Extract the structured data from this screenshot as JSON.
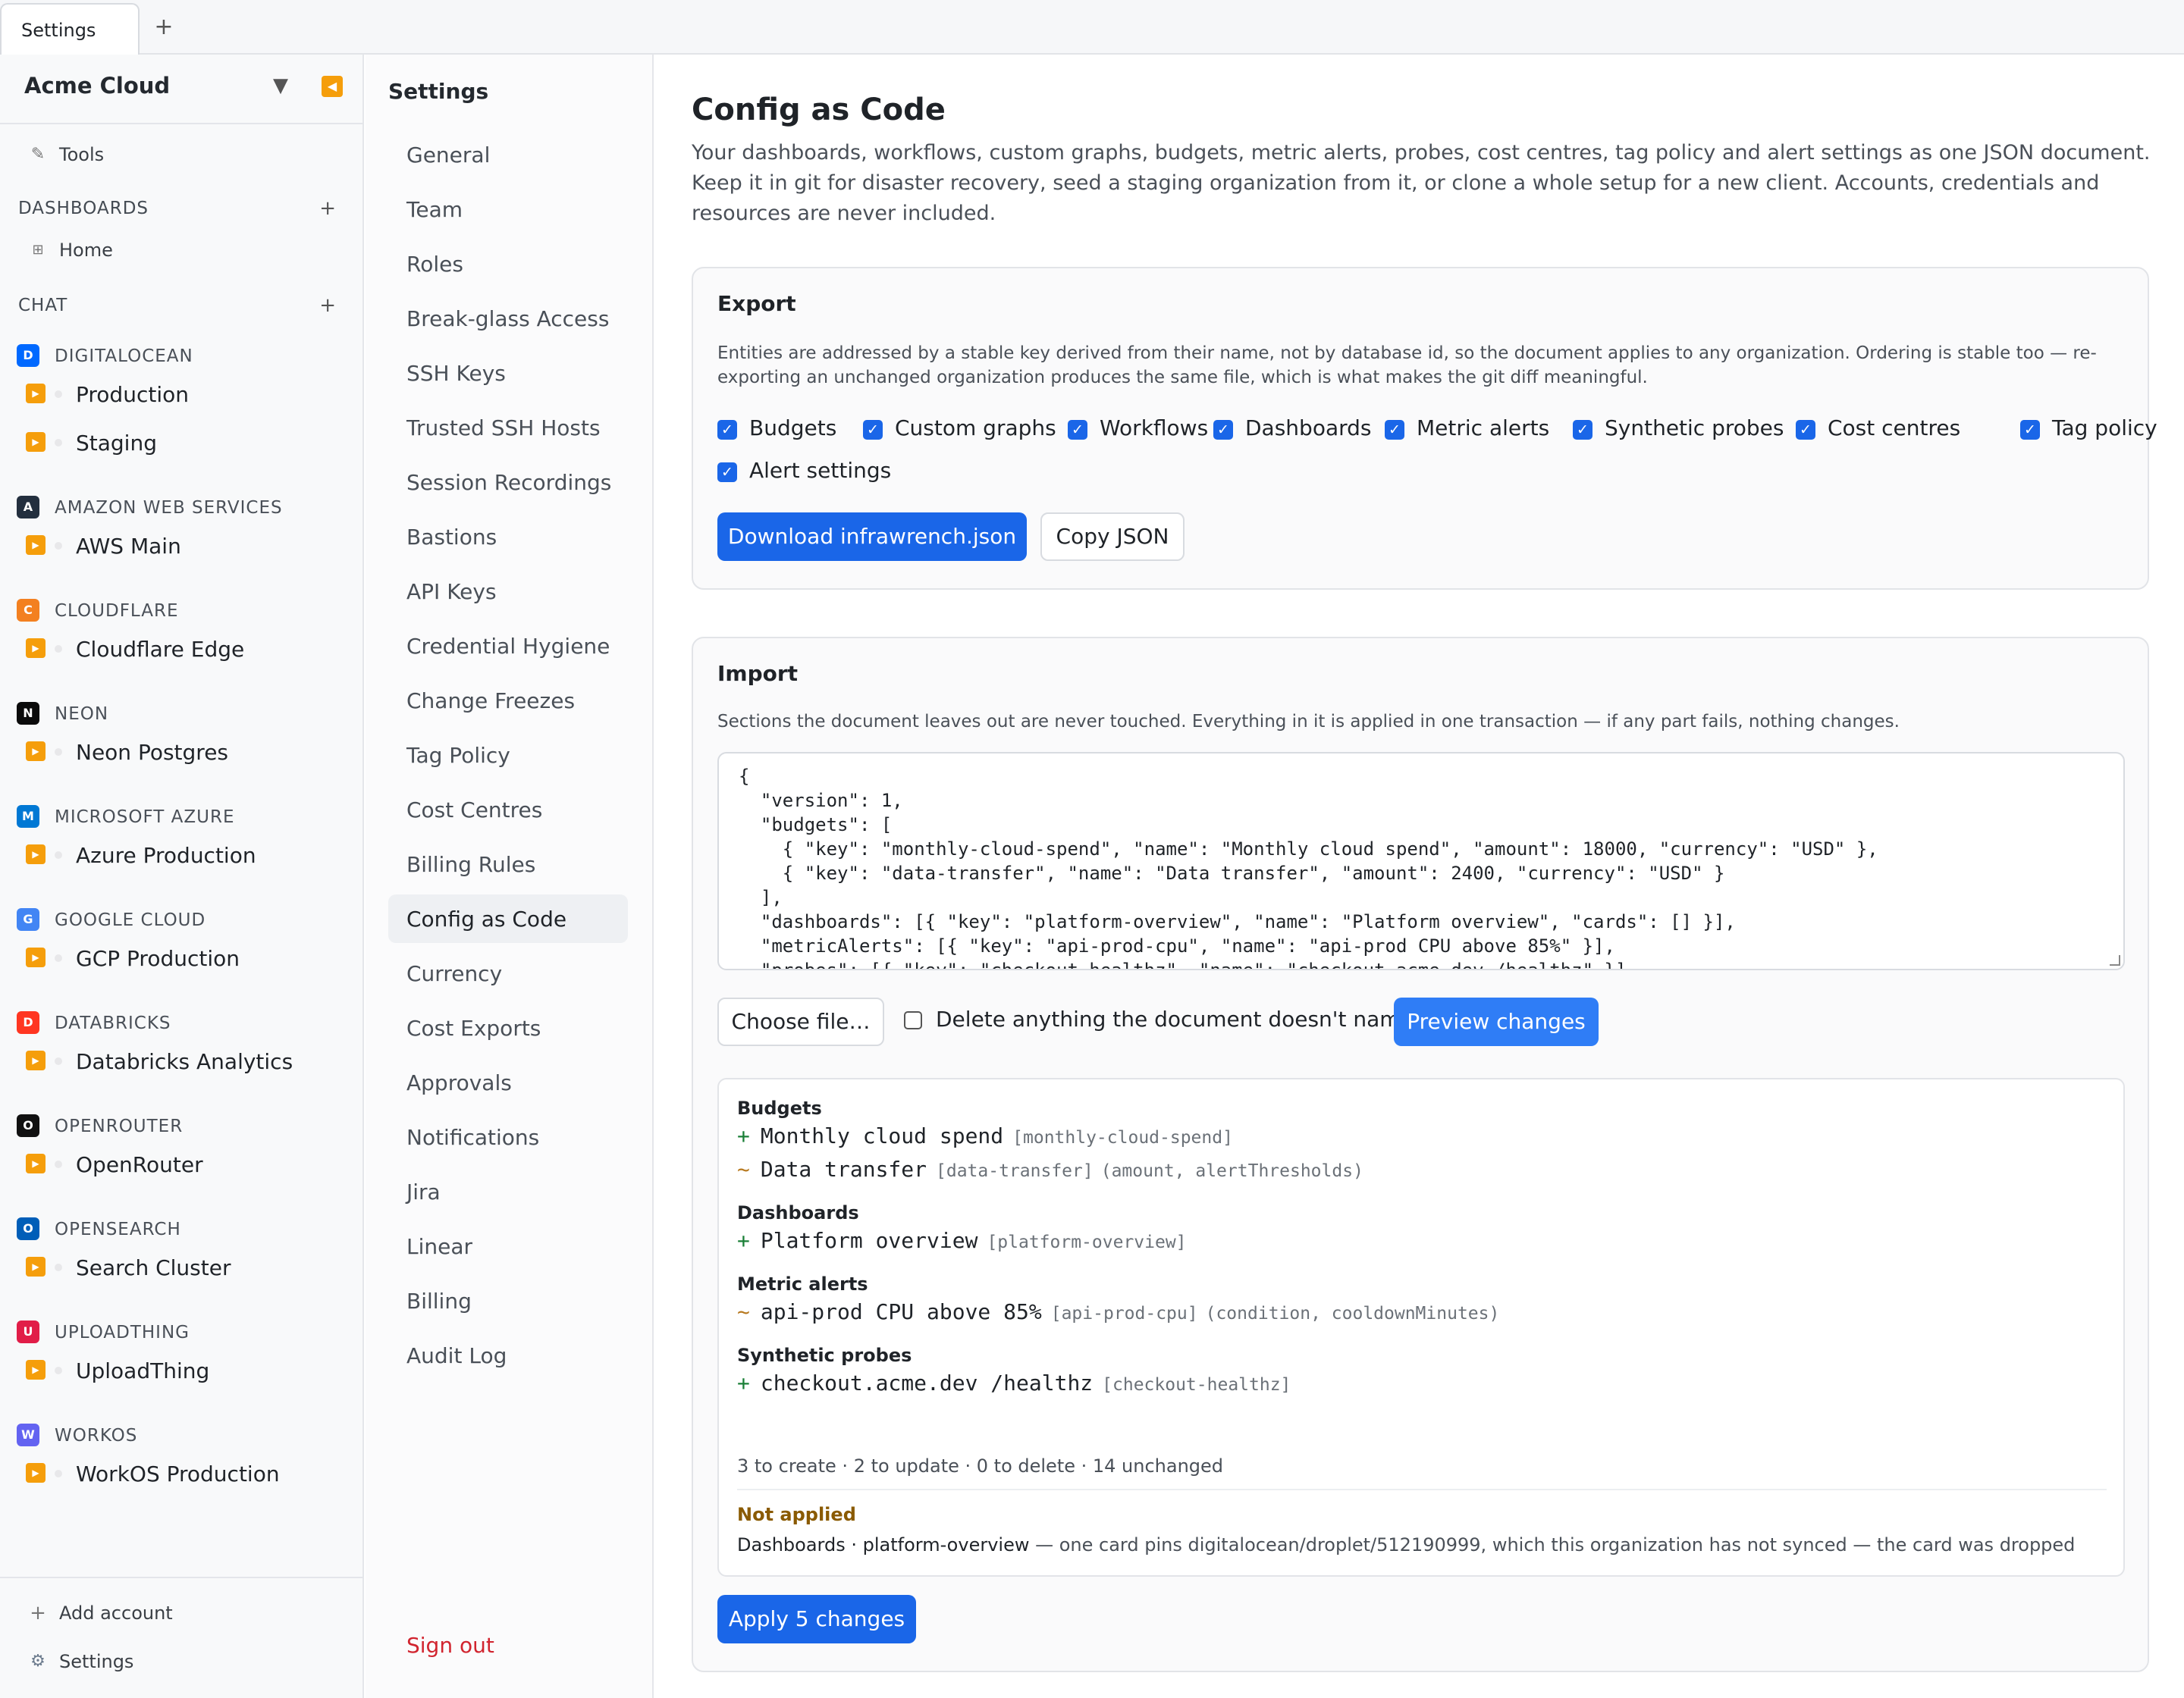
{
  "tabs": {
    "active": "Settings",
    "add": "+"
  },
  "sidebar": {
    "org_name": "Acme Cloud",
    "tools_label": "Tools",
    "dashboards_section": "DASHBOARDS",
    "home_label": "Home",
    "chat_section": "CHAT",
    "providers": [
      {
        "name": "DIGITALOCEAN",
        "color": "#0069ff",
        "accounts": [
          "Production",
          "Staging"
        ]
      },
      {
        "name": "AMAZON WEB SERVICES",
        "color": "#232f3e",
        "accounts": [
          "AWS Main"
        ]
      },
      {
        "name": "CLOUDFLARE",
        "color": "#f38020",
        "accounts": [
          "Cloudflare Edge"
        ]
      },
      {
        "name": "NEON",
        "color": "#0b0b0b",
        "accounts": [
          "Neon Postgres"
        ]
      },
      {
        "name": "MICROSOFT AZURE",
        "color": "#0078d4",
        "accounts": [
          "Azure Production"
        ]
      },
      {
        "name": "GOOGLE CLOUD",
        "color": "#4285f4",
        "accounts": [
          "GCP Production"
        ]
      },
      {
        "name": "DATABRICKS",
        "color": "#ff3621",
        "accounts": [
          "Databricks Analytics"
        ]
      },
      {
        "name": "OPENROUTER",
        "color": "#111111",
        "accounts": [
          "OpenRouter"
        ]
      },
      {
        "name": "OPENSEARCH",
        "color": "#005eb8",
        "accounts": [
          "Search Cluster"
        ]
      },
      {
        "name": "UPLOADTHING",
        "color": "#e11d48",
        "accounts": [
          "UploadThing"
        ]
      },
      {
        "name": "WORKOS",
        "color": "#6363f1",
        "accounts": [
          "WorkOS Production"
        ]
      }
    ],
    "add_account": "Add account",
    "settings": "Settings"
  },
  "settings_nav": {
    "title": "Settings",
    "items": [
      "General",
      "Team",
      "Roles",
      "Break-glass Access",
      "SSH Keys",
      "Trusted SSH Hosts",
      "Session Recordings",
      "Bastions",
      "API Keys",
      "Credential Hygiene",
      "Change Freezes",
      "Tag Policy",
      "Cost Centres",
      "Billing Rules",
      "Config as Code",
      "Currency",
      "Cost Exports",
      "Approvals",
      "Notifications",
      "Jira",
      "Linear",
      "Billing",
      "Audit Log"
    ],
    "active": "Config as Code",
    "sign_out": "Sign out"
  },
  "main": {
    "title": "Config as Code",
    "description": "Your dashboards, workflows, custom graphs, budgets, metric alerts, probes, cost centres, tag policy and alert settings as one JSON document. Keep it in git for disaster recovery, seed a staging organization from it, or clone a whole setup for a new client. Accounts, credentials and resources are never included.",
    "export": {
      "title": "Export",
      "description": "Entities are addressed by a stable key derived from their name, not by database id, so the document applies to any organization. Ordering is stable too — re-exporting an unchanged organization produces the same file, which is what makes the git diff meaningful.",
      "options": [
        {
          "label": "Budgets",
          "checked": true
        },
        {
          "label": "Custom graphs",
          "checked": true
        },
        {
          "label": "Workflows",
          "checked": true
        },
        {
          "label": "Dashboards",
          "checked": true
        },
        {
          "label": "Metric alerts",
          "checked": true
        },
        {
          "label": "Synthetic probes",
          "checked": true
        },
        {
          "label": "Cost centres",
          "checked": true
        },
        {
          "label": "Tag policy",
          "checked": true
        },
        {
          "label": "Alert settings",
          "checked": true
        }
      ],
      "download_label": "Download infrawrench.json",
      "copy_label": "Copy JSON"
    },
    "import": {
      "title": "Import",
      "description": "Sections the document leaves out are never touched. Everything in it is applied in one transaction — if any part fails, nothing changes.",
      "json_lines": [
        "{",
        "  \"version\": 1,",
        "  \"budgets\": [",
        "    { \"key\": \"monthly-cloud-spend\", \"name\": \"Monthly cloud spend\", \"amount\": 18000, \"currency\": \"USD\" },",
        "    { \"key\": \"data-transfer\", \"name\": \"Data transfer\", \"amount\": 2400, \"currency\": \"USD\" }",
        "  ],",
        "  \"dashboards\": [{ \"key\": \"platform-overview\", \"name\": \"Platform overview\", \"cards\": [] }],",
        "  \"metricAlerts\": [{ \"key\": \"api-prod-cpu\", \"name\": \"api-prod CPU above 85%\" }],",
        "  \"probes\": [{ \"key\": \"checkout-healthz\", \"name\": \"checkout.acme.dev /healthz\" }]"
      ],
      "choose_file_label": "Choose file…",
      "delete_unnamed_label": "Delete anything the document doesn't name",
      "delete_unnamed_checked": false,
      "preview_label": "Preview changes",
      "preview": {
        "groups": [
          {
            "title": "Budgets",
            "lines": [
              {
                "symbol": "+",
                "kind": "add",
                "name": "Monthly cloud spend",
                "key": "[monthly-cloud-spend]",
                "fields": ""
              },
              {
                "symbol": "~",
                "kind": "upd",
                "name": "Data transfer",
                "key": "[data-transfer]",
                "fields": "(amount, alertThresholds)"
              }
            ]
          },
          {
            "title": "Dashboards",
            "lines": [
              {
                "symbol": "+",
                "kind": "add",
                "name": "Platform overview",
                "key": "[platform-overview]",
                "fields": ""
              }
            ]
          },
          {
            "title": "Metric alerts",
            "lines": [
              {
                "symbol": "~",
                "kind": "upd",
                "name": "api-prod CPU above 85%",
                "key": "[api-prod-cpu]",
                "fields": "(condition, cooldownMinutes)"
              }
            ]
          },
          {
            "title": "Synthetic probes",
            "lines": [
              {
                "symbol": "+",
                "kind": "add",
                "name": "checkout.acme.dev /healthz",
                "key": "[checkout-healthz]",
                "fields": ""
              }
            ]
          }
        ],
        "summary": "3 to create · 2 to update · 0 to delete · 14 unchanged",
        "not_applied_title": "Not applied",
        "not_applied_entity": "Dashboards · platform-overview",
        "not_applied_reason": " — one card pins digitalocean/droplet/512190999, which this organization has not synced — the card was dropped"
      },
      "apply_label": "Apply 5 changes"
    }
  }
}
